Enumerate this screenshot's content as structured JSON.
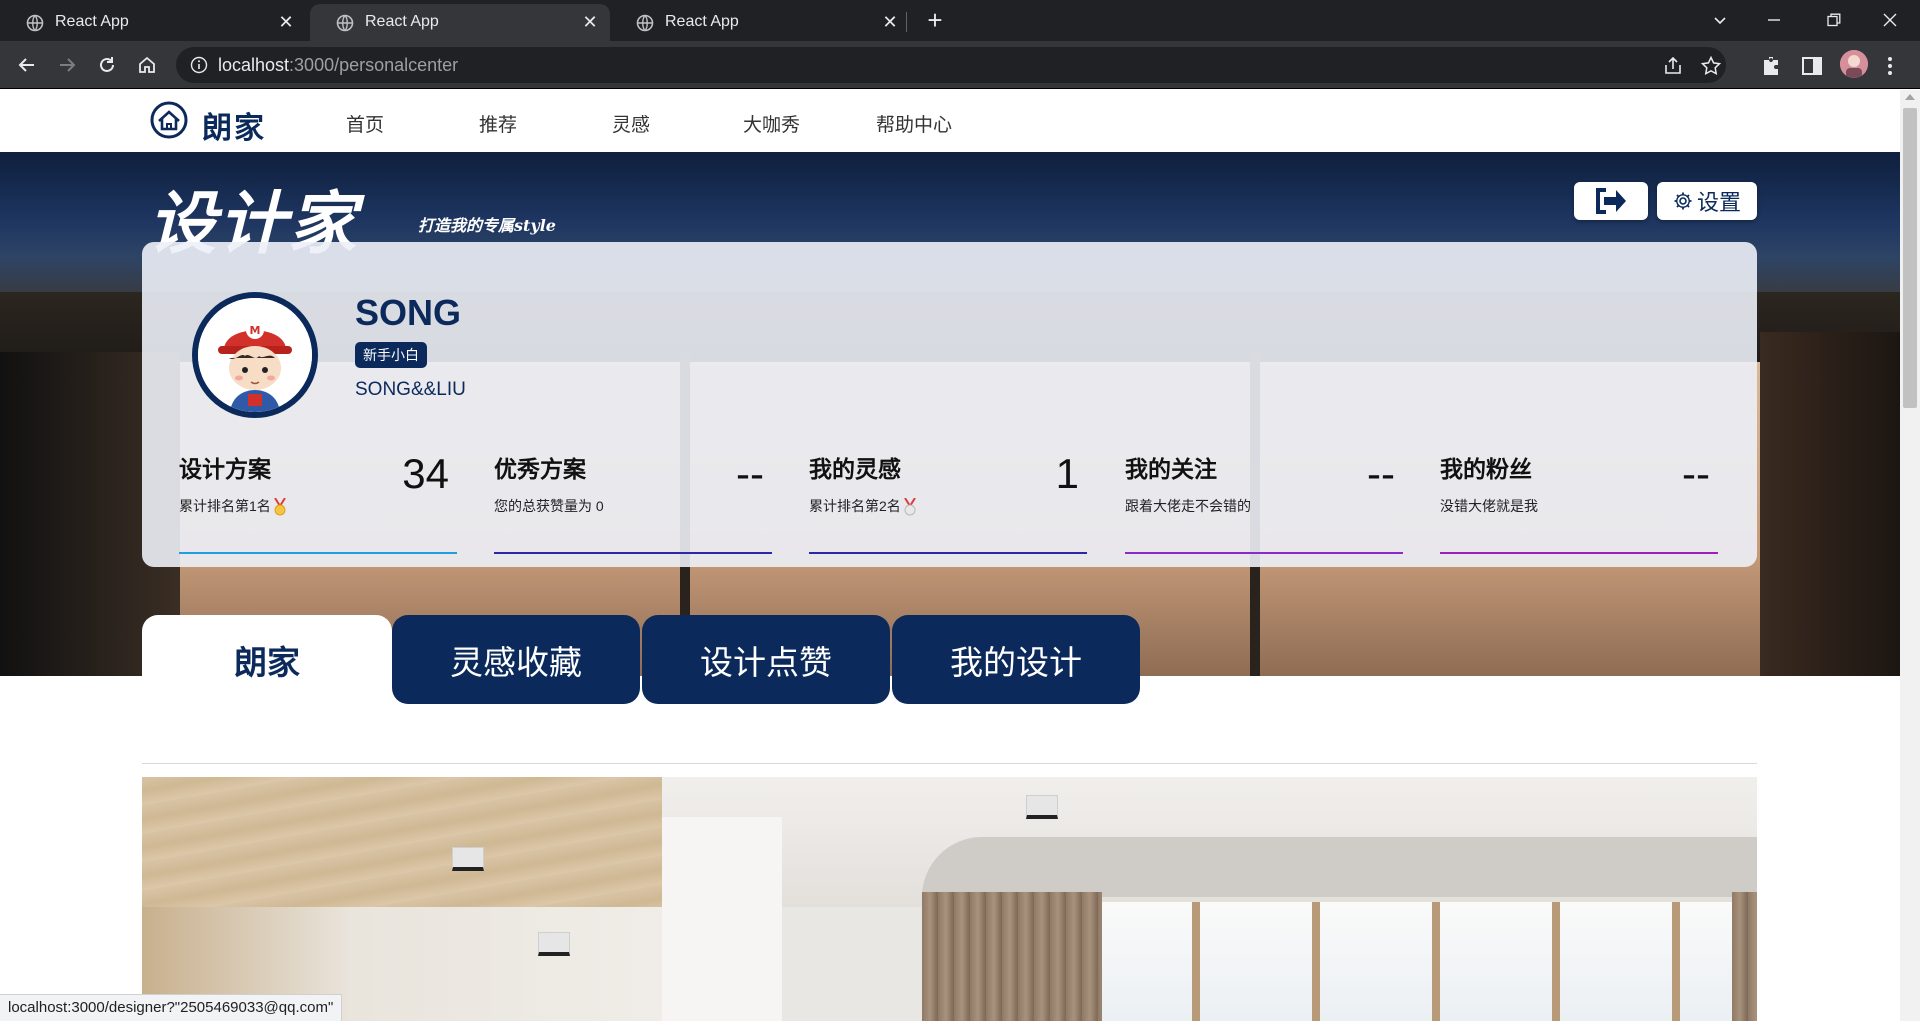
{
  "browser": {
    "tabs": [
      {
        "title": "React App"
      },
      {
        "title": "React App"
      },
      {
        "title": "React App"
      }
    ],
    "url_host": "localhost",
    "url_path": ":3000/personalcenter",
    "status_url": "localhost:3000/designer?\"2505469033@qq.com\""
  },
  "site": {
    "logo_text": "朗家",
    "nav": [
      "首页",
      "推荐",
      "灵感",
      "大咖秀",
      "帮助中心"
    ]
  },
  "hero": {
    "title": "设计家",
    "subtitle": "打造我的专属style",
    "settings_label": "设置"
  },
  "profile": {
    "name": "SONG",
    "badge": "新手小白",
    "handle": "SONG&&LIU"
  },
  "stats": [
    {
      "title": "设计方案",
      "value": "34",
      "desc": "累计排名第1名",
      "medal": true,
      "line_color": "#1ea0e0"
    },
    {
      "title": "优秀方案",
      "value": "--",
      "desc": "您的总获赞量为 0",
      "medal": false,
      "line_color": "#2a2aa8"
    },
    {
      "title": "我的灵感",
      "value": "1",
      "desc": "累计排名第2名",
      "medal": true,
      "line_color": "#2a2aa8"
    },
    {
      "title": "我的关注",
      "value": "--",
      "desc": "跟着大佬走不会错的",
      "medal": false,
      "line_color": "#8a2ac8"
    },
    {
      "title": "我的粉丝",
      "value": "--",
      "desc": "没错大佬就是我",
      "medal": false,
      "line_color": "#9a22b8"
    }
  ],
  "tabs": [
    {
      "label": "朗家",
      "active": true
    },
    {
      "label": "灵感收藏",
      "active": false
    },
    {
      "label": "设计点赞",
      "active": false
    },
    {
      "label": "我的设计",
      "active": false
    }
  ],
  "colors": {
    "brand": "#0b2a5b"
  }
}
